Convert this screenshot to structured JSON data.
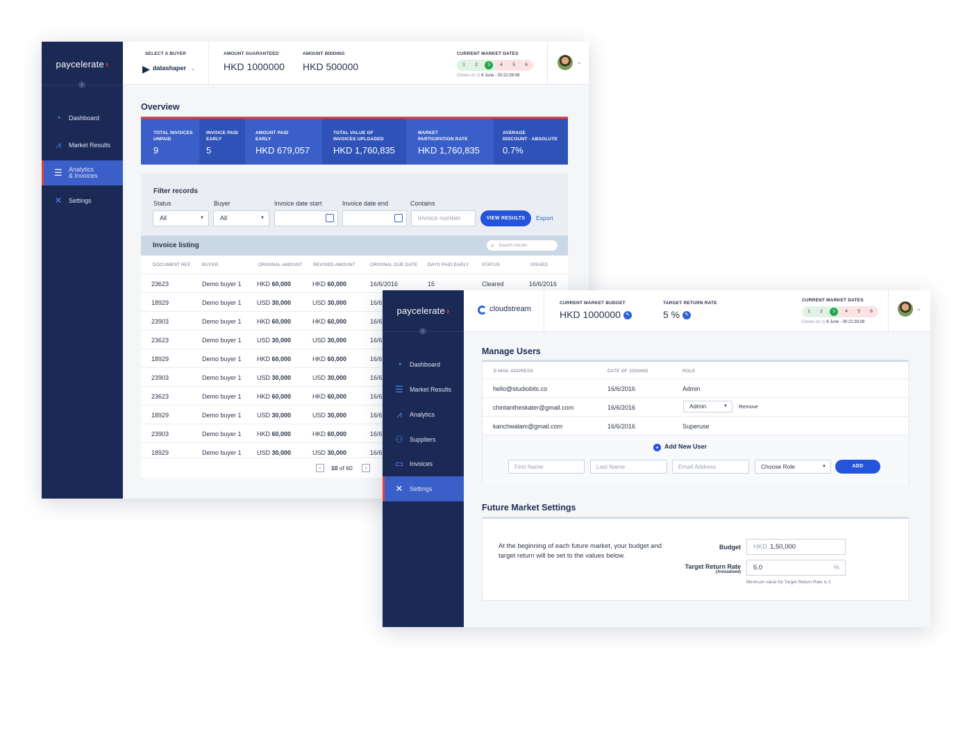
{
  "w1": {
    "logo": "paycelerate",
    "nav": [
      {
        "label": "Dashboard",
        "icon": "dashboard-icon"
      },
      {
        "label": "Market Results",
        "icon": "chart-icon"
      },
      {
        "label_line1": "Analytics",
        "label_line2": "& Invoices",
        "icon": "invoices-icon"
      },
      {
        "label": "Settings",
        "icon": "settings-icon"
      }
    ],
    "topbar": {
      "select_buyer_label": "SELECT A BUYER",
      "buyer_name": "datashaper",
      "amount_guaranteed_label": "AMOUNT GUARANTEED",
      "amount_guaranteed_value": "HKD 1000000",
      "amount_bidding_label": "AMOUNT BIDDING",
      "amount_bidding_value": "HKD 500000",
      "market_dates_label": "CURRENT MARKET DATES",
      "dates": [
        "1",
        "2",
        "3",
        "4",
        "5",
        "6"
      ],
      "current_date": "3",
      "closes": "Closes on",
      "closes_value": "6 June - 00:22:39:08"
    },
    "overview_title": "Overview",
    "overview": [
      {
        "l1": "TOTAL INVOICES",
        "l2": "UNPAID",
        "value": "9"
      },
      {
        "l1": "INVOICE PAID",
        "l2": "EARLY",
        "value": "5"
      },
      {
        "l1": "AMOUNT PAID",
        "l2": "EARLY",
        "value": "HKD 679,057"
      },
      {
        "l1": "TOTAL VALUE OF",
        "l2": "INVOICES UPLOADED",
        "value": "HKD 1,760,835"
      },
      {
        "l1": "MARKET",
        "l2": "PARTICIPATION RATE",
        "value": "HKD 1,760,835"
      },
      {
        "l1": "AVERAGE",
        "l2": "DISCOUNT - ABSOLUTE",
        "value": "0.7%"
      }
    ],
    "filter": {
      "title": "Filter records",
      "status_label": "Status",
      "status_value": "All",
      "buyer_label": "Buyer",
      "buyer_value": "All",
      "date_start_label": "Invoice date start",
      "date_end_label": "Invoice date end",
      "contains_label": "Contains",
      "contains_placeholder": "Invoice number",
      "view_results": "VIEW RESULTS",
      "export": "Export"
    },
    "listing": {
      "title": "Invoice listing",
      "search_placeholder": "Search results",
      "columns": [
        "DOCUMENT REF.",
        "BUYER",
        "ORIGINAL AMOUNT",
        "REVISED AMOUNT",
        "ORIGINAL DUE DATE",
        "DAYS PAID EARLY",
        "STATUS",
        "ISSUED"
      ],
      "rows": [
        {
          "ref": "23623",
          "buyer": "Demo buyer 1",
          "oc": "HKD",
          "ov": "60,000",
          "rc": "HKD",
          "rv": "60,000",
          "due": "16/6/2016",
          "days": "15",
          "status": "Cleared",
          "issued": "16/6/2016"
        },
        {
          "ref": "18929",
          "buyer": "Demo buyer 1",
          "oc": "USD",
          "ov": "30,000",
          "rc": "USD",
          "rv": "30,000",
          "due": "16/6"
        },
        {
          "ref": "23903",
          "buyer": "Demo buyer 1",
          "oc": "HKD",
          "ov": "60,000",
          "rc": "HKD",
          "rv": "60,000",
          "due": "16/6"
        },
        {
          "ref": "23623",
          "buyer": "Demo buyer 1",
          "oc": "USD",
          "ov": "30,000",
          "rc": "USD",
          "rv": "30,000",
          "due": "16/6"
        },
        {
          "ref": "18929",
          "buyer": "Demo buyer 1",
          "oc": "HKD",
          "ov": "60,000",
          "rc": "HKD",
          "rv": "60,000",
          "due": "16/6"
        },
        {
          "ref": "23903",
          "buyer": "Demo buyer 1",
          "oc": "USD",
          "ov": "30,000",
          "rc": "USD",
          "rv": "30,000",
          "due": "16/6"
        },
        {
          "ref": "23623",
          "buyer": "Demo buyer 1",
          "oc": "HKD",
          "ov": "60,000",
          "rc": "HKD",
          "rv": "60,000",
          "due": "16/6"
        },
        {
          "ref": "18929",
          "buyer": "Demo buyer 1",
          "oc": "USD",
          "ov": "30,000",
          "rc": "USD",
          "rv": "30,000",
          "due": "16/6"
        },
        {
          "ref": "23903",
          "buyer": "Demo buyer 1",
          "oc": "HKD",
          "ov": "60,000",
          "rc": "HKD",
          "rv": "60,000",
          "due": "16/6"
        },
        {
          "ref": "18929",
          "buyer": "Demo buyer 1",
          "oc": "USD",
          "ov": "30,000",
          "rc": "USD",
          "rv": "30,000",
          "due": "16/6"
        }
      ],
      "page_current": "10",
      "page_of": "of 60"
    }
  },
  "w2": {
    "logo": "paycelerate",
    "nav": [
      {
        "label": "Dashboard",
        "icon": "dashboard-icon"
      },
      {
        "label": "Market Results",
        "icon": "market-results-icon"
      },
      {
        "label": "Analytics",
        "icon": "analytics-icon"
      },
      {
        "label": "Suppliers",
        "icon": "suppliers-icon"
      },
      {
        "label": "Invoices",
        "icon": "invoices-icon"
      },
      {
        "label": "Settings",
        "icon": "settings-icon"
      }
    ],
    "topbar": {
      "company": "cloudstream",
      "budget_label": "CURRENT MARKET BUDGET",
      "budget_value": "HKD 1000000",
      "return_label": "TARGET RETURN RATE",
      "return_value": "5 %",
      "market_dates_label": "CURRENT MARKET DATES",
      "dates": [
        "1",
        "2",
        "3",
        "4",
        "5",
        "6"
      ],
      "current_date": "3",
      "closes": "Closes on",
      "closes_value": "6 June - 00:22:39:08"
    },
    "manage_users": {
      "title": "Manage Users",
      "columns": [
        "E-MAIL ADDRESS",
        "DATE OF JOINING",
        "ROLE"
      ],
      "users": [
        {
          "email": "hello@studiobits.co",
          "date": "16/6/2016",
          "role": "Admin"
        },
        {
          "email": "chintantheskater@gmail.com",
          "date": "16/6/2016",
          "role": "Admin",
          "remove": "Remove"
        },
        {
          "email": "kanchwalam@gmail.com",
          "date": "16/6/2016",
          "role": "Superuse"
        }
      ],
      "add_new_user": "Add New User",
      "first_name_ph": "First Name",
      "last_name_ph": "Last Name",
      "email_ph": "Email Address",
      "choose_role": "Choose Role",
      "add": "ADD"
    },
    "future_market": {
      "title": "Future Market Settings",
      "description": "At the beginning of each future market, your budget and target return will be set to the values below.",
      "budget_label": "Budget",
      "budget_prefix": "HKD",
      "budget_value": "1,50,000",
      "rate_label": "Target Return Rate",
      "rate_sub": "(Annualized)",
      "rate_value": "5.0",
      "rate_suffix": "%",
      "hint": "Minimum value for Target Return Rate is 2"
    }
  },
  "colors": {
    "sidebar": "#1b2a55",
    "accent": "#3a5fc8",
    "brand_red": "#e2403c",
    "button": "#2354d9"
  }
}
